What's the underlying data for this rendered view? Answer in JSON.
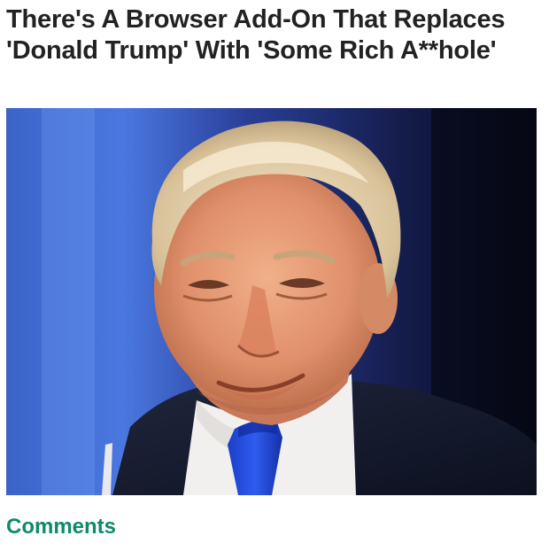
{
  "article": {
    "headline": "There's A Browser Add-On That Replaces 'Donald Trump' With 'Some Rich A**hole'",
    "comments_label": "Comments"
  },
  "photo": {
    "subject": "man-in-suit-portrait"
  },
  "colors": {
    "comments_link": "#0e8a6c",
    "headline_text": "#222222",
    "photo_background": "#1a2560"
  }
}
